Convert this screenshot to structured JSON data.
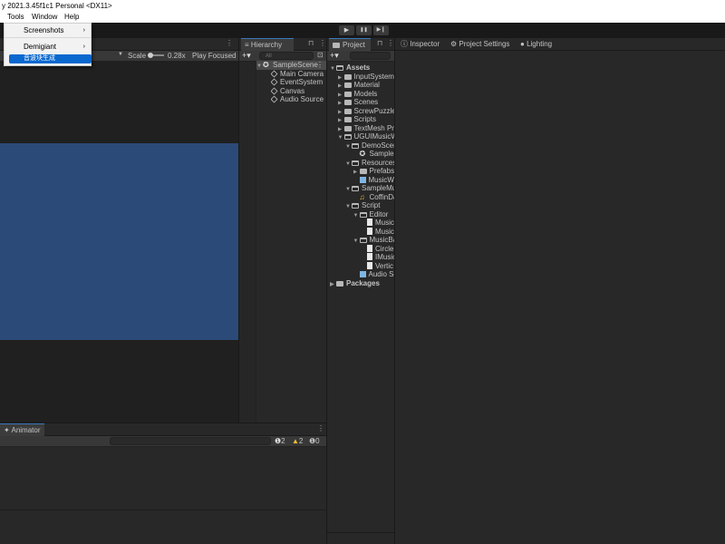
{
  "window": {
    "title": "y 2021.3.45f1c1 Personal <DX11>"
  },
  "menubar": {
    "items": [
      "Tools",
      "Window",
      "Help"
    ]
  },
  "dropdown": {
    "items": [
      {
        "label": "Screenshots",
        "submenu": true
      },
      {
        "label": "Demigiant",
        "submenu": true
      },
      {
        "label": "音波块生成",
        "submenu": false
      }
    ]
  },
  "playbar": {
    "play": "▶",
    "pause": "❚❚",
    "step": "▶❙"
  },
  "scene": {
    "scale_label": "Scale",
    "scale_value": "0.28x",
    "play_mode": "Play Focused",
    "canvas_color": "#2c4a78"
  },
  "hierarchy": {
    "tab": "Hierarchy",
    "search_placeholder": "All",
    "scene_name": "SampleScene",
    "items": [
      "Main Camera",
      "EventSystem",
      "Canvas",
      "Audio Source"
    ]
  },
  "project": {
    "tab": "Project",
    "tree": [
      {
        "label": "Assets",
        "depth": 0,
        "open": true,
        "bold": true,
        "icon": "folder-icon"
      },
      {
        "label": "InputSystem",
        "depth": 1,
        "icon": "folder-icon"
      },
      {
        "label": "Material",
        "depth": 1,
        "icon": "folder-icon"
      },
      {
        "label": "Models",
        "depth": 1,
        "icon": "folder-icon"
      },
      {
        "label": "Scenes",
        "depth": 1,
        "icon": "folder-icon"
      },
      {
        "label": "ScrewPuzzle",
        "depth": 1,
        "icon": "folder-icon"
      },
      {
        "label": "Scripts",
        "depth": 1,
        "icon": "folder-icon"
      },
      {
        "label": "TextMesh Pro",
        "depth": 1,
        "icon": "folder-icon"
      },
      {
        "label": "UGUIMusicW",
        "depth": 1,
        "open": true,
        "icon": "folder-icon"
      },
      {
        "label": "DemoScen",
        "depth": 2,
        "open": true,
        "icon": "folder-icon"
      },
      {
        "label": "SampleS",
        "depth": 3,
        "leaf": true,
        "icon": "unity-scene-icon"
      },
      {
        "label": "Resources",
        "depth": 2,
        "open": true,
        "icon": "folder-icon"
      },
      {
        "label": "Prefabs",
        "depth": 3,
        "icon": "folder-icon"
      },
      {
        "label": "MusicWa",
        "depth": 3,
        "leaf": true,
        "icon": "prefab-icon"
      },
      {
        "label": "SampleMu",
        "depth": 2,
        "open": true,
        "icon": "folder-icon"
      },
      {
        "label": "CoffinDa",
        "depth": 3,
        "leaf": true,
        "icon": "audio-clip-icon"
      },
      {
        "label": "Script",
        "depth": 2,
        "open": true,
        "icon": "folder-icon"
      },
      {
        "label": "Editor",
        "depth": 3,
        "open": true,
        "icon": "folder-icon"
      },
      {
        "label": "Music",
        "depth": 4,
        "leaf": true,
        "icon": "script-icon"
      },
      {
        "label": "Music",
        "depth": 4,
        "leaf": true,
        "icon": "script-icon"
      },
      {
        "label": "MusicBa",
        "depth": 3,
        "open": true,
        "icon": "folder-icon"
      },
      {
        "label": "Circle",
        "depth": 4,
        "leaf": true,
        "icon": "script-icon"
      },
      {
        "label": "IMusic",
        "depth": 4,
        "leaf": true,
        "icon": "script-icon"
      },
      {
        "label": "Vertic",
        "depth": 4,
        "leaf": true,
        "icon": "script-icon"
      },
      {
        "label": "Audio So",
        "depth": 3,
        "leaf": true,
        "icon": "prefab-icon"
      },
      {
        "label": "Packages",
        "depth": 0,
        "bold": true,
        "icon": "folder-icon"
      }
    ]
  },
  "inspector": {
    "tabs": [
      "Inspector",
      "Project Settings",
      "Lighting"
    ]
  },
  "animator": {
    "tab": "Animator",
    "counts": {
      "info": "2",
      "warning": "2",
      "error": "0"
    }
  }
}
